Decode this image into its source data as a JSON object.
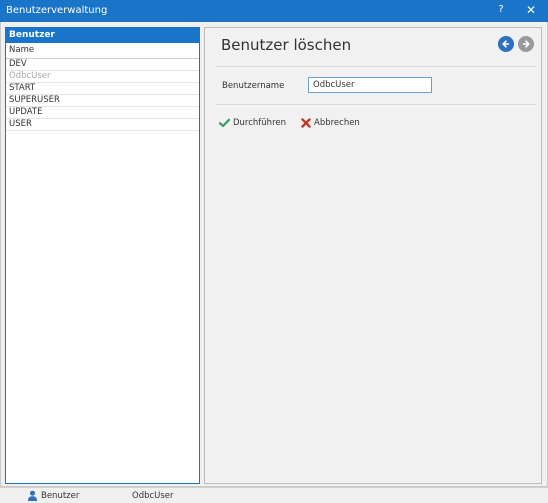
{
  "window": {
    "title": "Benutzerverwaltung",
    "help_label": "?",
    "close_label": "✕"
  },
  "sidebar": {
    "header": "Benutzer",
    "column_label": "Name",
    "items": [
      {
        "label": "DEV",
        "muted": false
      },
      {
        "label": "OdbcUser",
        "muted": true
      },
      {
        "label": "START",
        "muted": false
      },
      {
        "label": "SUPERUSER",
        "muted": false
      },
      {
        "label": "UPDATE",
        "muted": false
      },
      {
        "label": "USER",
        "muted": false
      }
    ]
  },
  "main": {
    "title": "Benutzer löschen",
    "username_label": "Benutzername",
    "username_value": "OdbcUser",
    "execute_label": "Durchführen",
    "cancel_label": "Abbrechen"
  },
  "icons": {
    "back": "arrow-left-circle-icon",
    "forward": "arrow-right-circle-icon",
    "execute": "checkmark-icon",
    "cancel": "cross-icon",
    "user": "user-icon"
  },
  "colors": {
    "accent": "#1a75c9",
    "success": "#3a9a6a",
    "danger": "#c0392b"
  },
  "statusbar": {
    "section_label": "Benutzer",
    "current_user": "OdbcUser"
  }
}
